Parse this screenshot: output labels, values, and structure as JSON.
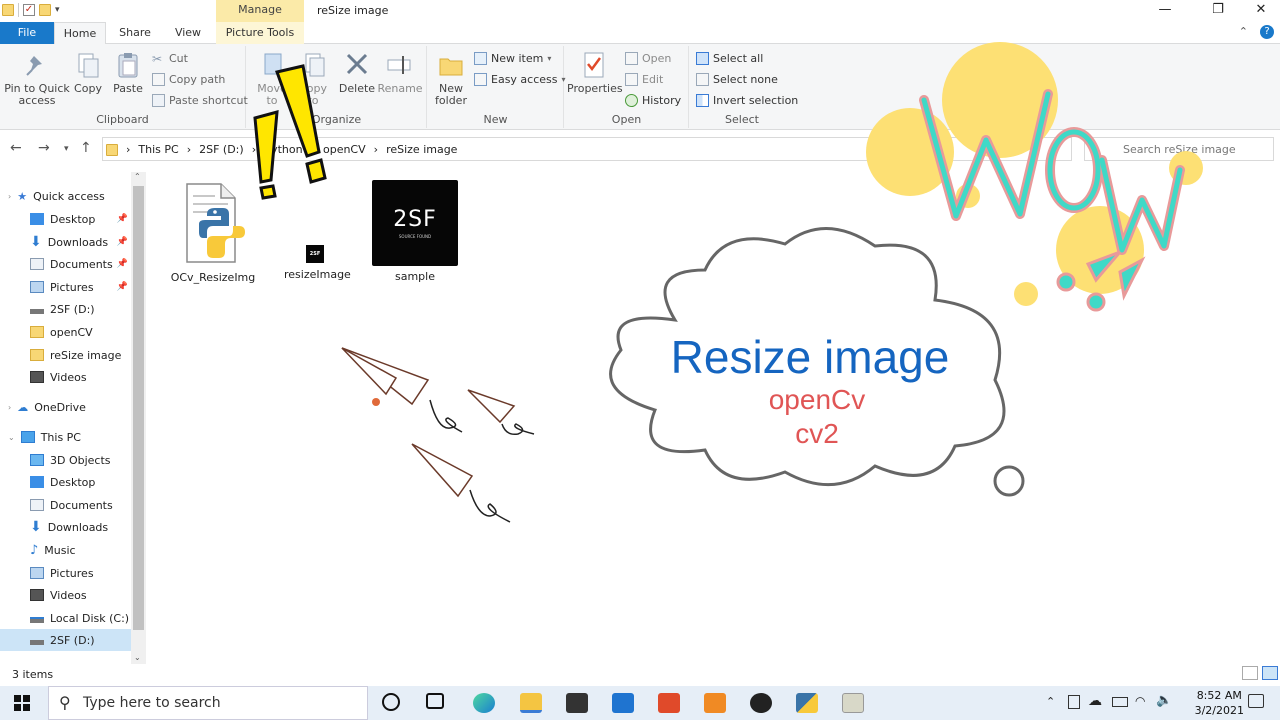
{
  "titlebar": {
    "manage_tab": "Manage",
    "title": "reSize image",
    "minimize": "—",
    "maximize": "❐",
    "close": "✕"
  },
  "ribbon_tabs": {
    "file": "File",
    "home": "Home",
    "share": "Share",
    "view": "View",
    "picture_tools": "Picture Tools",
    "collapse": "⌃",
    "help": "?"
  },
  "ribbon": {
    "clipboard": {
      "label": "Clipboard",
      "pin": "Pin to Quick access",
      "copy": "Copy",
      "paste": "Paste",
      "cut": "Cut",
      "copy_path": "Copy path",
      "paste_shortcut": "Paste shortcut"
    },
    "organize": {
      "label": "Organize",
      "move_to": "Move to",
      "copy_to": "Copy to",
      "delete": "Delete",
      "rename": "Rename"
    },
    "new": {
      "label": "New",
      "new_folder": "New folder",
      "new_item": "New item",
      "easy_access": "Easy access"
    },
    "open": {
      "label": "Open",
      "properties": "Properties",
      "open": "Open",
      "edit": "Edit",
      "history": "History"
    },
    "select": {
      "label": "Select",
      "select_all": "Select all",
      "select_none": "Select none",
      "invert": "Invert selection"
    }
  },
  "address": {
    "crumbs": [
      "This PC",
      "2SF (D:)",
      "python",
      "openCV",
      "reSize image"
    ],
    "search_placeholder": "Search reSize image"
  },
  "nav": {
    "quick_access": "Quick access",
    "quick_items": [
      "Desktop",
      "Downloads",
      "Documents",
      "Pictures",
      "2SF (D:)",
      "openCV",
      "reSize image",
      "Videos"
    ],
    "onedrive": "OneDrive",
    "this_pc": "This PC",
    "pc_items": [
      "3D Objects",
      "Desktop",
      "Documents",
      "Downloads",
      "Music",
      "Pictures",
      "Videos",
      "Local Disk (C:)",
      "2SF (D:)"
    ]
  },
  "files": [
    {
      "name": "OCv_ResizeImg",
      "icon": "python-file-icon"
    },
    {
      "name": "resizeImage",
      "icon": "image-thumbnail"
    },
    {
      "name": "sample",
      "icon": "image-thumbnail"
    }
  ],
  "thumb_text": "2SF",
  "thumb_subtext": "SOURCE FOUND",
  "overlay": {
    "title": "Resize image",
    "line2": "openCv",
    "line3": "cv2",
    "wow": "WOW!!"
  },
  "status": {
    "items": "3 items"
  },
  "taskbar": {
    "search_placeholder": "Type here to search",
    "time": "8:52 AM",
    "date": "3/2/2021"
  },
  "colors": {
    "accent": "#1979ca",
    "manage": "#fbeaa8",
    "title_blue": "#1565c0",
    "subtitle_red": "#e05555",
    "wow_teal": "#3fd9c7",
    "wow_yellow": "#fde074"
  }
}
